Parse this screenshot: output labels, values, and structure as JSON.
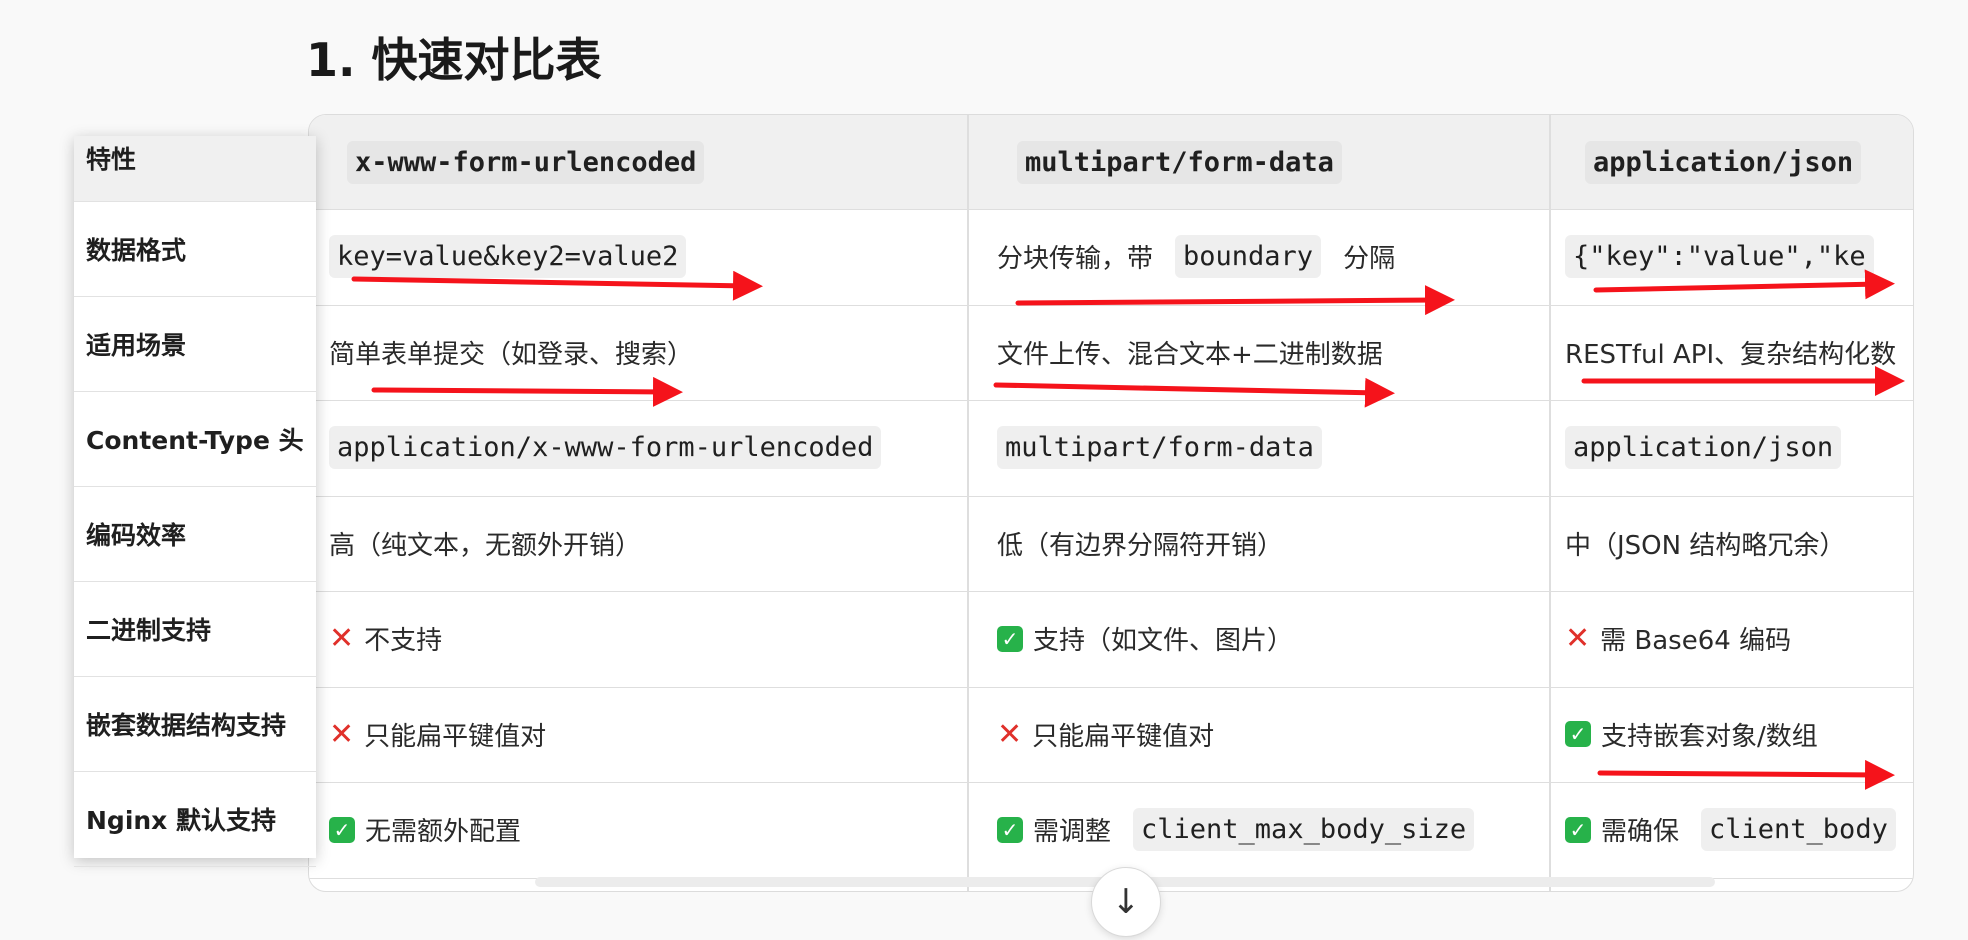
{
  "heading": "1. 快速对比表",
  "columns": {
    "feature": "特性",
    "urlencoded": "x-www-form-urlencoded",
    "multipart": "multipart/form-data",
    "json": "application/json"
  },
  "rows": [
    {
      "feature": "数据格式",
      "c1": {
        "code": "key=value&key2=value2"
      },
      "c2": {
        "pre": "分块传输，带",
        "code": "boundary",
        "post": "分隔"
      },
      "c3": {
        "code": "{\"key\":\"value\",\"ke"
      }
    },
    {
      "feature": "适用场景",
      "c1": {
        "text": "简单表单提交（如登录、搜索）"
      },
      "c2": {
        "text": "文件上传、混合文本+二进制数据"
      },
      "c3": {
        "text": "RESTful API、复杂结构化数"
      }
    },
    {
      "feature": "Content-Type 头",
      "c1": {
        "code": "application/x-www-form-urlencoded"
      },
      "c2": {
        "code": "multipart/form-data"
      },
      "c3": {
        "code": "application/json"
      }
    },
    {
      "feature": "编码效率",
      "c1": {
        "text": "高（纯文本，无额外开销）"
      },
      "c2": {
        "text": "低（有边界分隔符开销）"
      },
      "c3": {
        "text": "中（JSON 结构略冗余）"
      }
    },
    {
      "feature": "二进制支持",
      "c1": {
        "mark": "✕",
        "text": "不支持"
      },
      "c2": {
        "mark": "✓",
        "text": "支持（如文件、图片）"
      },
      "c3": {
        "mark": "✕",
        "text": "需 Base64 编码"
      }
    },
    {
      "feature": "嵌套数据结构支持",
      "c1": {
        "mark": "✕",
        "text": "只能扁平键值对"
      },
      "c2": {
        "mark": "✕",
        "text": "只能扁平键值对"
      },
      "c3": {
        "mark": "✓",
        "text": "支持嵌套对象/数组"
      }
    },
    {
      "feature": "Nginx 默认支持",
      "c1": {
        "mark": "✓",
        "text": "无需额外配置"
      },
      "c2": {
        "mark": "✓",
        "pre": "需调整",
        "code": "client_max_body_size"
      },
      "c3": {
        "mark": "✓",
        "pre": "需确保",
        "code": "client_body"
      }
    }
  ],
  "icons": {
    "scroll_down": "arrow-down-icon",
    "cross": "cross-mark-icon",
    "check": "check-mark-icon"
  },
  "colors": {
    "annotation_arrow": "#f5131b",
    "check_green": "#27b24a",
    "cross_red": "#e0302a"
  }
}
